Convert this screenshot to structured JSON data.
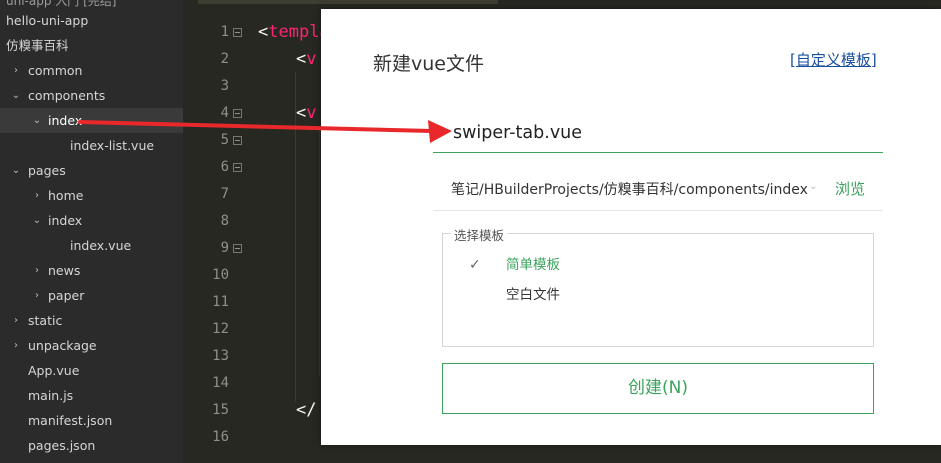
{
  "sidebar": {
    "clipped_title": "uni-app 入门 [完结]",
    "items": [
      {
        "label": "hello-uni-app",
        "chev": ""
      },
      {
        "label": "仿糗事百科",
        "chev": ""
      },
      {
        "label": "common",
        "chev": "›"
      },
      {
        "label": "components",
        "chev": "⌄"
      },
      {
        "label": "index",
        "chev": "⌄"
      },
      {
        "label": "index-list.vue",
        "chev": ""
      },
      {
        "label": "pages",
        "chev": "⌄"
      },
      {
        "label": "home",
        "chev": "›"
      },
      {
        "label": "index",
        "chev": "⌄"
      },
      {
        "label": "index.vue",
        "chev": ""
      },
      {
        "label": "news",
        "chev": "›"
      },
      {
        "label": "paper",
        "chev": "›"
      },
      {
        "label": "static",
        "chev": "›"
      },
      {
        "label": "unpackage",
        "chev": "›"
      },
      {
        "label": "App.vue",
        "chev": ""
      },
      {
        "label": "main.js",
        "chev": ""
      },
      {
        "label": "manifest.json",
        "chev": ""
      },
      {
        "label": "pages.json",
        "chev": ""
      }
    ]
  },
  "editor": {
    "line_numbers": [
      "1",
      "2",
      "3",
      "4",
      "5",
      "6",
      "7",
      "8",
      "9",
      "10",
      "11",
      "12",
      "13",
      "14",
      "15",
      "16"
    ],
    "line1_bracket": "<",
    "line1_tag": "templa",
    "line2_bracket": "<",
    "line2_tag": "v",
    "line4_bracket": "<",
    "line4_tag": "v",
    "line15_bracket": "</",
    "colors": {
      "tag": "#f92672",
      "gutter": "#8f908a",
      "background": "#272822"
    }
  },
  "dialog": {
    "title": "新建vue文件",
    "custom_template_link": "[自定义模板]",
    "filename_value": "swiper-tab.vue",
    "path_value": "笔记/HBuilderProjects/仿糗事百科/components/index",
    "path_dropdown_icon": "chevron-down-icon",
    "browse_label": "浏览",
    "template_group_label": "选择模板",
    "templates": [
      {
        "label": "简单模板",
        "selected": true,
        "check": "✓"
      },
      {
        "label": "空白文件",
        "selected": false,
        "check": ""
      }
    ],
    "create_button_label": "创建(N)",
    "accent_color": "#3aa35c"
  }
}
